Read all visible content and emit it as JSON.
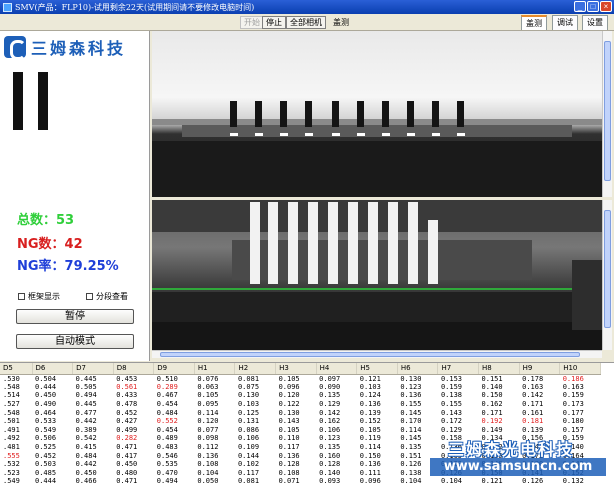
{
  "window": {
    "title": "SMV(产品：FLP10)-试用剩余22天(试用期间请不要修改电脑时间)",
    "min": "_",
    "max": "□",
    "close": "×"
  },
  "toolbar": {
    "start": "开始",
    "stop": "停止",
    "all_cameras": "全部相机",
    "mode": "盖测",
    "tabs": [
      "盖测",
      "调试",
      "设置"
    ]
  },
  "logo": {
    "text": "三姆森科技"
  },
  "stats": {
    "total": "总数：53",
    "ng": "NG数：42",
    "ng_rate": "NG率：79.25%"
  },
  "options": {
    "show_frame": "框架显示",
    "step_view": "分段查看"
  },
  "buttons": {
    "pause": "暂停",
    "auto_mode": "自动模式"
  },
  "table": {
    "headers": [
      "D5",
      "D6",
      "D7",
      "D8",
      "D9",
      "H1",
      "H2",
      "H3",
      "H4",
      "H5",
      "H6",
      "H7",
      "H8",
      "H9",
      "H10"
    ],
    "rows": [
      [
        ".530",
        "0.504",
        "0.445",
        "0.453",
        "0.510",
        "0.076",
        "0.081",
        "0.105",
        "0.097",
        "0.121",
        "0.130",
        "0.153",
        "0.151",
        "0.178",
        "0.186"
      ],
      [
        ".548",
        "0.444",
        "0.505",
        "0.561",
        "0.289",
        "0.063",
        "0.075",
        "0.096",
        "0.090",
        "0.103",
        "0.123",
        "0.159",
        "0.140",
        "0.163",
        "0.163"
      ],
      [
        ".514",
        "0.450",
        "0.494",
        "0.433",
        "0.467",
        "0.105",
        "0.130",
        "0.120",
        "0.135",
        "0.124",
        "0.136",
        "0.138",
        "0.150",
        "0.142",
        "0.159"
      ],
      [
        ".527",
        "0.490",
        "0.445",
        "0.478",
        "0.454",
        "0.095",
        "0.103",
        "0.122",
        "0.129",
        "0.136",
        "0.155",
        "0.155",
        "0.162",
        "0.171",
        "0.173"
      ],
      [
        ".548",
        "0.464",
        "0.477",
        "0.452",
        "0.484",
        "0.114",
        "0.125",
        "0.130",
        "0.142",
        "0.139",
        "0.145",
        "0.143",
        "0.171",
        "0.161",
        "0.177"
      ],
      [
        ".501",
        "0.533",
        "0.442",
        "0.427",
        "0.552",
        "0.120",
        "0.131",
        "0.143",
        "0.162",
        "0.152",
        "0.170",
        "0.172",
        "0.192",
        "0.181",
        "0.180"
      ],
      [
        ".491",
        "0.549",
        "0.389",
        "0.499",
        "0.454",
        "0.077",
        "0.086",
        "0.105",
        "0.106",
        "0.105",
        "0.114",
        "0.129",
        "0.149",
        "0.139",
        "0.157"
      ],
      [
        ".492",
        "0.506",
        "0.542",
        "0.282",
        "0.489",
        "0.098",
        "0.106",
        "0.110",
        "0.123",
        "0.119",
        "0.145",
        "0.158",
        "0.134",
        "0.156",
        "0.159"
      ],
      [
        ".481",
        "0.525",
        "0.415",
        "0.471",
        "0.483",
        "0.112",
        "0.109",
        "0.117",
        "0.135",
        "0.114",
        "0.135",
        "0.136",
        "0.132",
        "0.142",
        "0.140"
      ],
      [
        ".555",
        "0.452",
        "0.484",
        "0.417",
        "0.546",
        "0.136",
        "0.144",
        "0.136",
        "0.160",
        "0.150",
        "0.151",
        "0.165",
        "0.165",
        "0.172",
        "0.164"
      ],
      [
        ".532",
        "0.503",
        "0.442",
        "0.450",
        "0.535",
        "0.108",
        "0.102",
        "0.128",
        "0.128",
        "0.136",
        "0.126",
        "0.129",
        "0.140",
        "0.130",
        "0.145"
      ],
      [
        ".523",
        "0.485",
        "0.450",
        "0.480",
        "0.470",
        "0.104",
        "0.117",
        "0.108",
        "0.140",
        "0.111",
        "0.138",
        "0.126",
        "0.150",
        "0.141",
        "0.152"
      ],
      [
        ".549",
        "0.444",
        "0.466",
        "0.471",
        "0.494",
        "0.050",
        "0.081",
        "0.071",
        "0.093",
        "0.096",
        "0.104",
        "0.104",
        "0.121",
        "0.126",
        "0.132"
      ]
    ],
    "red_cells": [
      [
        0,
        14
      ],
      [
        1,
        3
      ],
      [
        1,
        4
      ],
      [
        5,
        4
      ],
      [
        5,
        12
      ],
      [
        5,
        13
      ],
      [
        7,
        3
      ],
      [
        9,
        0
      ]
    ]
  },
  "watermark": {
    "brand": "三姆森光电科技",
    "url": "www.samsuncn.com"
  },
  "colors": {
    "total": "#2fcf3a",
    "ng": "#d81f1f",
    "rate": "#1f3fd8",
    "brand": "#1d5fb8",
    "tab_accent": "#e68b2c"
  }
}
